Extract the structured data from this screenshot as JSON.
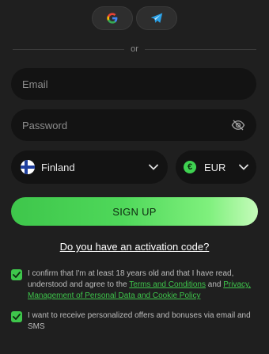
{
  "social": {
    "google_icon": "google-icon",
    "telegram_icon": "telegram-icon"
  },
  "divider": {
    "label": "or"
  },
  "email": {
    "placeholder": "Email"
  },
  "password": {
    "placeholder": "Password",
    "icon": "eye-off-icon"
  },
  "country": {
    "value": "Finland",
    "flag": "finland-flag-icon"
  },
  "currency": {
    "value": "EUR",
    "symbol": "€"
  },
  "signup": {
    "label": "SIGN UP"
  },
  "activation": {
    "label": "Do you have an activation code?"
  },
  "terms": {
    "checked": true,
    "text_before": "I confirm that I'm at least 18 years old and that I have read, understood and agree to the ",
    "link1": "Terms and Conditions",
    "text_middle": " and ",
    "link2": "Privacy, Management of Personal Data and Cookie Policy"
  },
  "offers": {
    "checked": true,
    "text": "I want to receive personalized offers and bonuses via email and SMS"
  },
  "colors": {
    "accent": "#3ec64b",
    "background": "#1f1f1f",
    "field": "#131313"
  }
}
